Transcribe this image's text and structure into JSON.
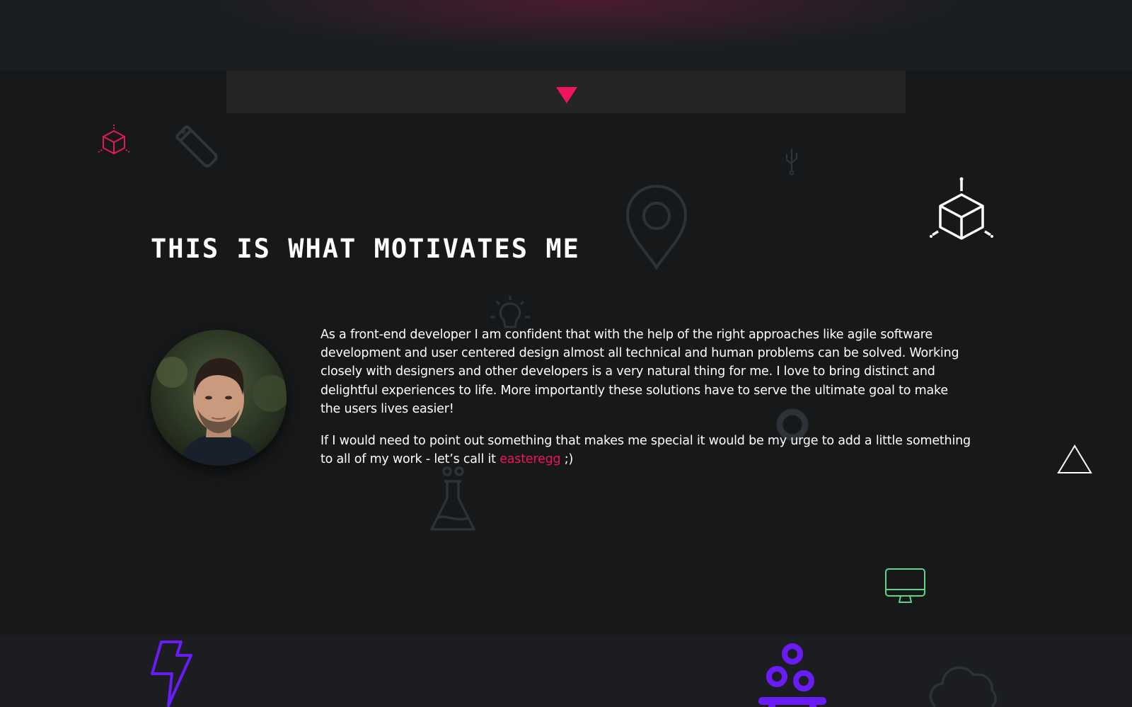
{
  "section": {
    "heading": "THIS IS WHAT MOTIVATES ME",
    "paragraph_1": "As a front-end developer I am confident that with the help of the right approaches like agile software development and user centered design almost all technical and human problems can be solved. Working closely with designers and other developers is a very natural thing for me. I love to bring distinct and delightful experiences to life. More importantly these solutions have to serve the ultimate goal to make the users lives easier!",
    "paragraph_2_before": "If I would need to point out something that makes me special it would be my urge to add a little something to all of my work - let’s call it ",
    "easteregg_link": "easteregg",
    "paragraph_2_after": " ;)"
  },
  "colors": {
    "accent": "#f0145a",
    "background": "#171819",
    "band": "#1b1e21",
    "tab_bar": "#252525",
    "muted_icon": "#2c3238",
    "purple_icon": "#6a1cf6",
    "green_icon": "#5fd387",
    "text": "#ffffff"
  },
  "icons": [
    "scroll-down-triangle-icon",
    "cube-icon",
    "usb-stick-icon",
    "usb-symbol-icon",
    "location-pin-icon",
    "lightbulb-icon",
    "ring-icon",
    "flask-icon",
    "triangle-outline-icon",
    "monitor-icon",
    "lightning-icon",
    "molecules-icon",
    "cloud-icon"
  ]
}
